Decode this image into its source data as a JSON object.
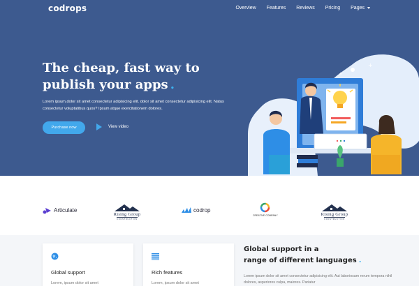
{
  "brand": {
    "logo": "codrops"
  },
  "nav": {
    "items": [
      "Overview",
      "Features",
      "Reviews",
      "Pricing",
      "Pages"
    ]
  },
  "hero": {
    "title_line1": "The cheap, fast way to",
    "title_line2": "publish your apps",
    "title_accent": ".",
    "description": "Lorem ipsum,dolor sit amet consectetur adipisicing elit. dolor sit amet consectetur adipisicing elit. Natus consectetur voluptatibus quos? Ipsum atque exercitationem dolores.",
    "primary_button": "Purchase now",
    "video_link": "View video"
  },
  "partners": {
    "articulate": "Articulate",
    "rising_name": "Rising Group",
    "rising_sub": "CONSTRUCTION",
    "codrop": "codrop",
    "creative": "CREATIVE COMPANY"
  },
  "features": {
    "cards": [
      {
        "title": "Global support",
        "text": "Lorem, ipsum dolor sit amet",
        "icon": "globe-icon"
      },
      {
        "title": "Rich features",
        "text": "Lorem, ipsum dolor sit amet",
        "icon": "list-icon"
      }
    ],
    "side_title": "Global support in a range of different languages",
    "side_title_line1": "Global support in a",
    "side_title_line2": "range of different languages",
    "side_accent": ".",
    "side_text": "Lorem ipsum dolor sit amet consectetur adipisicing elit. Aut laboriosam rerum tempora nihil dolores, asperiores culpa, maiores. Pariatur"
  },
  "colors": {
    "hero_bg": "#3d5a8f",
    "accent": "#42a8ec",
    "nav_text": "#ffffff"
  }
}
